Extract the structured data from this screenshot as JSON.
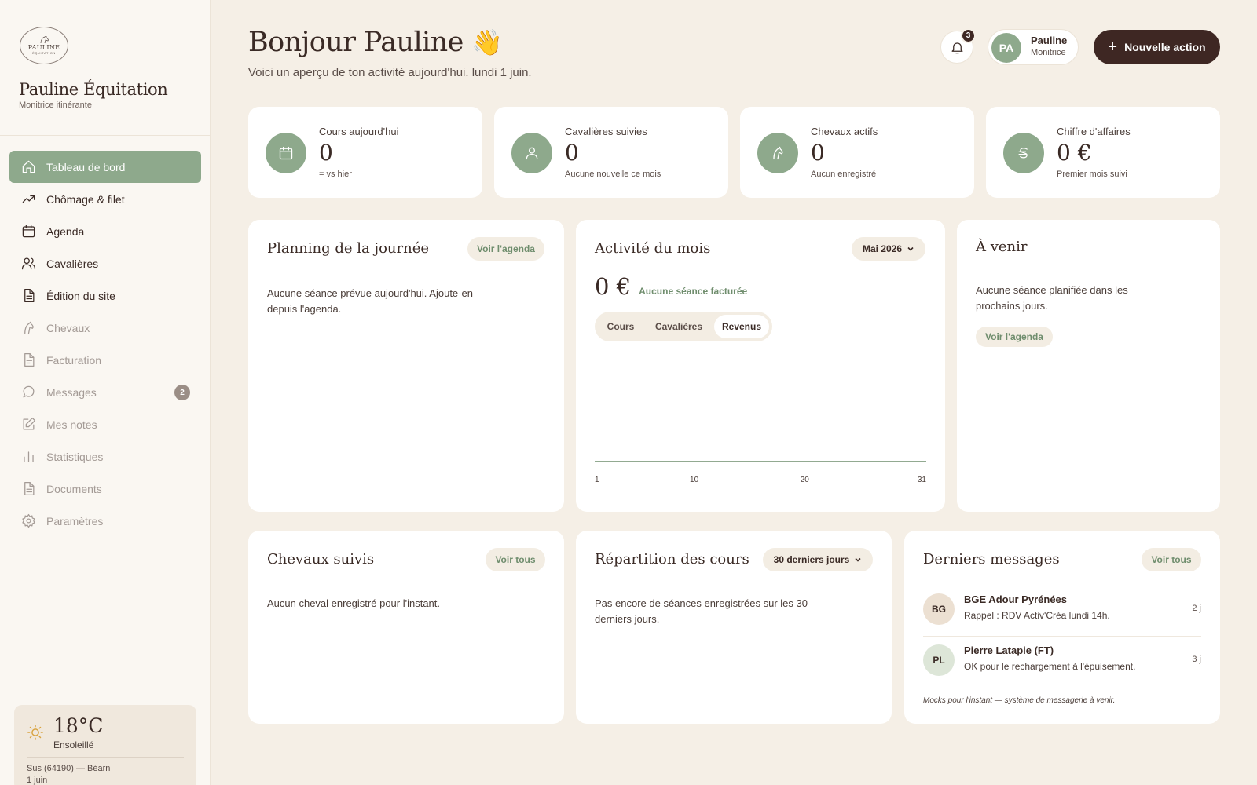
{
  "brand": {
    "logo_line1": "PAULINE",
    "logo_line2": "ÉQUITATION",
    "name": "Pauline Équitation",
    "subtitle": "Monitrice itinérante"
  },
  "nav": {
    "items": [
      {
        "label": "Tableau de bord",
        "icon": "home-icon"
      },
      {
        "label": "Chômage & filet",
        "icon": "trending-up-icon"
      },
      {
        "label": "Agenda",
        "icon": "calendar-icon"
      },
      {
        "label": "Cavalières",
        "icon": "users-icon"
      },
      {
        "label": "Édition du site",
        "icon": "document-icon"
      },
      {
        "label": "Chevaux",
        "icon": "horse-icon"
      },
      {
        "label": "Facturation",
        "icon": "invoice-icon"
      },
      {
        "label": "Messages",
        "icon": "message-icon",
        "badge": "2"
      },
      {
        "label": "Mes notes",
        "icon": "edit-icon"
      },
      {
        "label": "Statistiques",
        "icon": "bar-chart-icon"
      },
      {
        "label": "Documents",
        "icon": "file-icon"
      },
      {
        "label": "Paramètres",
        "icon": "gear-icon"
      }
    ]
  },
  "weather": {
    "temp": "18°C",
    "condition": "Ensoleillé",
    "location": "Sus (64190) — Béarn",
    "date": "1 juin"
  },
  "header": {
    "greeting": "Bonjour Pauline",
    "emoji": "👋",
    "subtitle": "Voici un aperçu de ton activité aujourd'hui. lundi 1 juin.",
    "notif_count": "3",
    "user_initials": "PA",
    "user_name": "Pauline",
    "user_role": "Monitrice",
    "new_action": "Nouvelle action"
  },
  "stats": [
    {
      "label": "Cours aujourd'hui",
      "value": "0",
      "note": "= vs hier",
      "icon": "calendar-icon"
    },
    {
      "label": "Cavalières suivies",
      "value": "0",
      "note": "Aucune nouvelle ce mois",
      "icon": "user-icon"
    },
    {
      "label": "Chevaux actifs",
      "value": "0",
      "note": "Aucun enregistré",
      "icon": "horse-icon"
    },
    {
      "label": "Chiffre d'affaires",
      "value": "0 €",
      "note": "Premier mois suivi",
      "icon": "currency-icon"
    }
  ],
  "planning": {
    "title": "Planning de la journée",
    "link": "Voir l'agenda",
    "empty_line1": "Aucune séance prévue aujourd'hui. Ajoute-en",
    "empty_line2": "depuis l'agenda."
  },
  "activity": {
    "title": "Activité du mois",
    "period": "Mai 2026",
    "amount": "0 €",
    "amount_note": "Aucune séance facturée",
    "tabs": [
      "Cours",
      "Cavalières",
      "Revenus"
    ],
    "active_tab": "Revenus"
  },
  "chart_data": {
    "type": "line",
    "x": [
      1,
      10,
      20,
      31
    ],
    "x_ticks": [
      "1",
      "10",
      "20",
      "31"
    ],
    "series": [
      {
        "values": [
          0,
          0,
          0,
          0
        ]
      }
    ],
    "xlim": [
      1,
      31
    ],
    "color": "#6f8d6d"
  },
  "upcoming": {
    "title": "À venir",
    "empty_line1": "Aucune séance planifiée dans les",
    "empty_line2": "prochains jours.",
    "link": "Voir l'agenda"
  },
  "horses": {
    "title": "Chevaux suivis",
    "link": "Voir tous",
    "empty": "Aucun cheval enregistré pour l'instant."
  },
  "breakdown": {
    "title": "Répartition des cours",
    "period": "30 derniers jours",
    "empty_line1": "Pas encore de séances enregistrées sur les 30",
    "empty_line2": "derniers jours."
  },
  "messages": {
    "title": "Derniers messages",
    "link": "Voir tous",
    "items": [
      {
        "initials": "BG",
        "name": "BGE Adour Pyrénées",
        "text": "Rappel : RDV Activ'Créa lundi 14h.",
        "time": "2 j"
      },
      {
        "initials": "PL",
        "name": "Pierre Latapie (FT)",
        "text": "OK pour le rechargement à l'épuisement.",
        "time": "3 j"
      }
    ],
    "footnote": "Mocks pour l'instant — système de messagerie à venir."
  }
}
